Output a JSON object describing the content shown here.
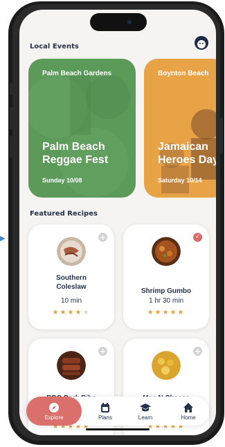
{
  "sections": {
    "local_events": "Local Events",
    "featured_recipes": "Featured Recipes"
  },
  "events": [
    {
      "location": "Palm Beach Gardens",
      "title_line1": "Palm Beach",
      "title_line2": "Reggae Fest",
      "date": "Sunday 10/08",
      "color": "#5c9a59"
    },
    {
      "location": "Boynton Beach",
      "title_line1": "Jamaican",
      "title_line2": "Heroes Day",
      "date": "Saturday 10/14",
      "color": "#e8a346"
    }
  ],
  "recipes": [
    {
      "name_line1": "Southern",
      "name_line2": "Coleslaw",
      "time": "10 min",
      "rating": 4,
      "status": "add"
    },
    {
      "name_line1": "Shrimp Gumbo",
      "name_line2": "",
      "time": "1 hr 30 min",
      "rating": 5,
      "status": "added"
    },
    {
      "name_line1": "BBQ Pork Ribs",
      "name_line2": "",
      "time": "",
      "rating": 5,
      "status": "add"
    },
    {
      "name_line1": "Mac N Cheese",
      "name_line2": "",
      "time": "",
      "rating": 5,
      "status": "add"
    }
  ],
  "nav": {
    "explore": "Explore",
    "plans": "Plans",
    "learn": "Learn",
    "home": "Home",
    "active": "explore"
  },
  "icons": {
    "avatar": "avatar-icon",
    "add": "plus-icon",
    "added": "check-icon",
    "explore": "compass-icon",
    "plans": "calendar-icon",
    "learn": "graduation-cap-icon",
    "home": "home-icon"
  },
  "colors": {
    "accent": "#db6f6c",
    "star": "#e7a23c",
    "text": "#27324a"
  }
}
